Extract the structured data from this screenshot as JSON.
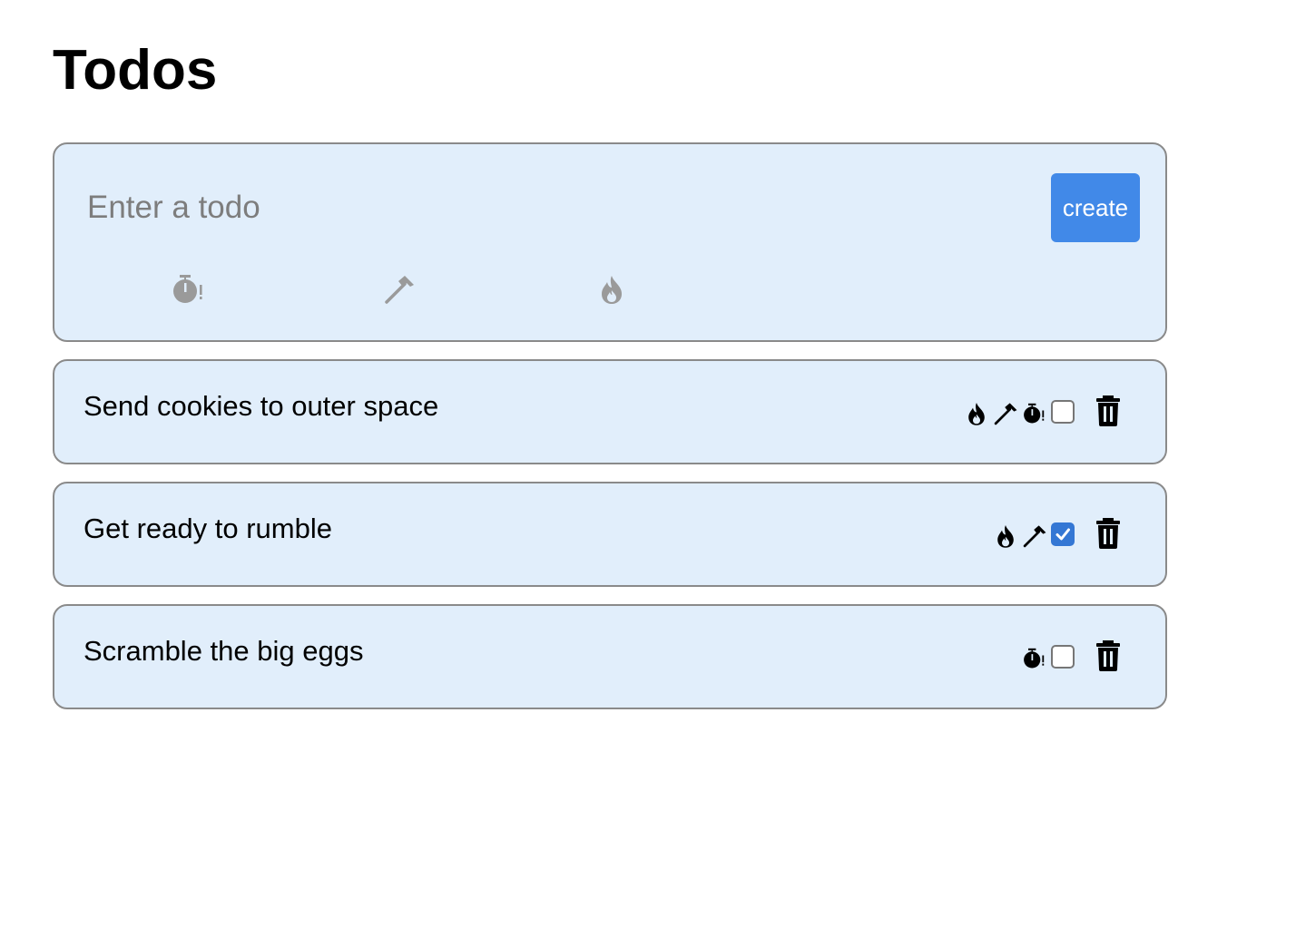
{
  "page": {
    "title": "Todos"
  },
  "create_form": {
    "placeholder": "Enter a todo",
    "value": "",
    "create_label": "create",
    "tag_options": [
      "stopwatch-icon",
      "hammer-icon",
      "fire-icon"
    ],
    "tag_option_color": "#9a9a9a"
  },
  "todos": [
    {
      "text": "Send cookies to outer space",
      "tags": [
        "fire-icon",
        "hammer-icon",
        "stopwatch-icon"
      ],
      "done": false
    },
    {
      "text": "Get ready to rumble",
      "tags": [
        "fire-icon",
        "hammer-icon"
      ],
      "done": true
    },
    {
      "text": "Scramble the big eggs",
      "tags": [
        "stopwatch-icon"
      ],
      "done": false
    }
  ],
  "colors": {
    "card_background": "#e1eefb",
    "card_border": "#8a8a8a",
    "accent": "#4189e8",
    "checkbox_checked": "#3477d4"
  }
}
